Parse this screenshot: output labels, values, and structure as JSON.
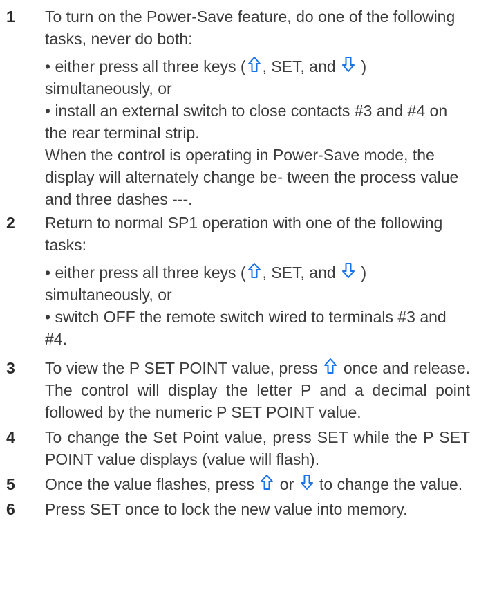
{
  "arrow_color": "#1a73e8",
  "icons": {
    "up": "up-arrow-icon",
    "down": "down-arrow-icon"
  },
  "steps": [
    {
      "number": "1",
      "intro": "To turn on the Power-Save feature, do one of the following tasks, never do both:",
      "bullet1_a": "• either press all three keys (",
      "bullet1_b": ", SET, and",
      "bullet1_c": ")",
      "bullet1_d": "simultaneously, or",
      "bullet2": "• install an external switch to close contacts #3 and #4 on the rear terminal strip.",
      "note": "When the control is operating in Power-Save mode, the display will alternately change be- tween the process value and three dashes ---."
    },
    {
      "number": "2",
      "intro": "Return to normal SP1 operation with one of the following tasks:",
      "bullet1_a": "• either press all three keys (",
      "bullet1_b": ", SET, and",
      "bullet1_c": ")",
      "bullet1_d": "simultaneously, or",
      "bullet2": "• switch OFF the remote switch wired to terminals #3 and #4."
    },
    {
      "number": "3",
      "text_a": "To view the P SET POINT value, press",
      "text_b": "once and release. The control will display the letter P and a decimal point followed by the numeric P SET POINT value."
    },
    {
      "number": "4",
      "text": "To change the Set Point value, press SET while the P SET POINT value displays (value will flash)."
    },
    {
      "number": "5",
      "text_a": "Once the value flashes, press",
      "text_b": "or",
      "text_c": "to change the value."
    },
    {
      "number": "6",
      "text": "Press SET once to lock the new value into memory."
    }
  ]
}
